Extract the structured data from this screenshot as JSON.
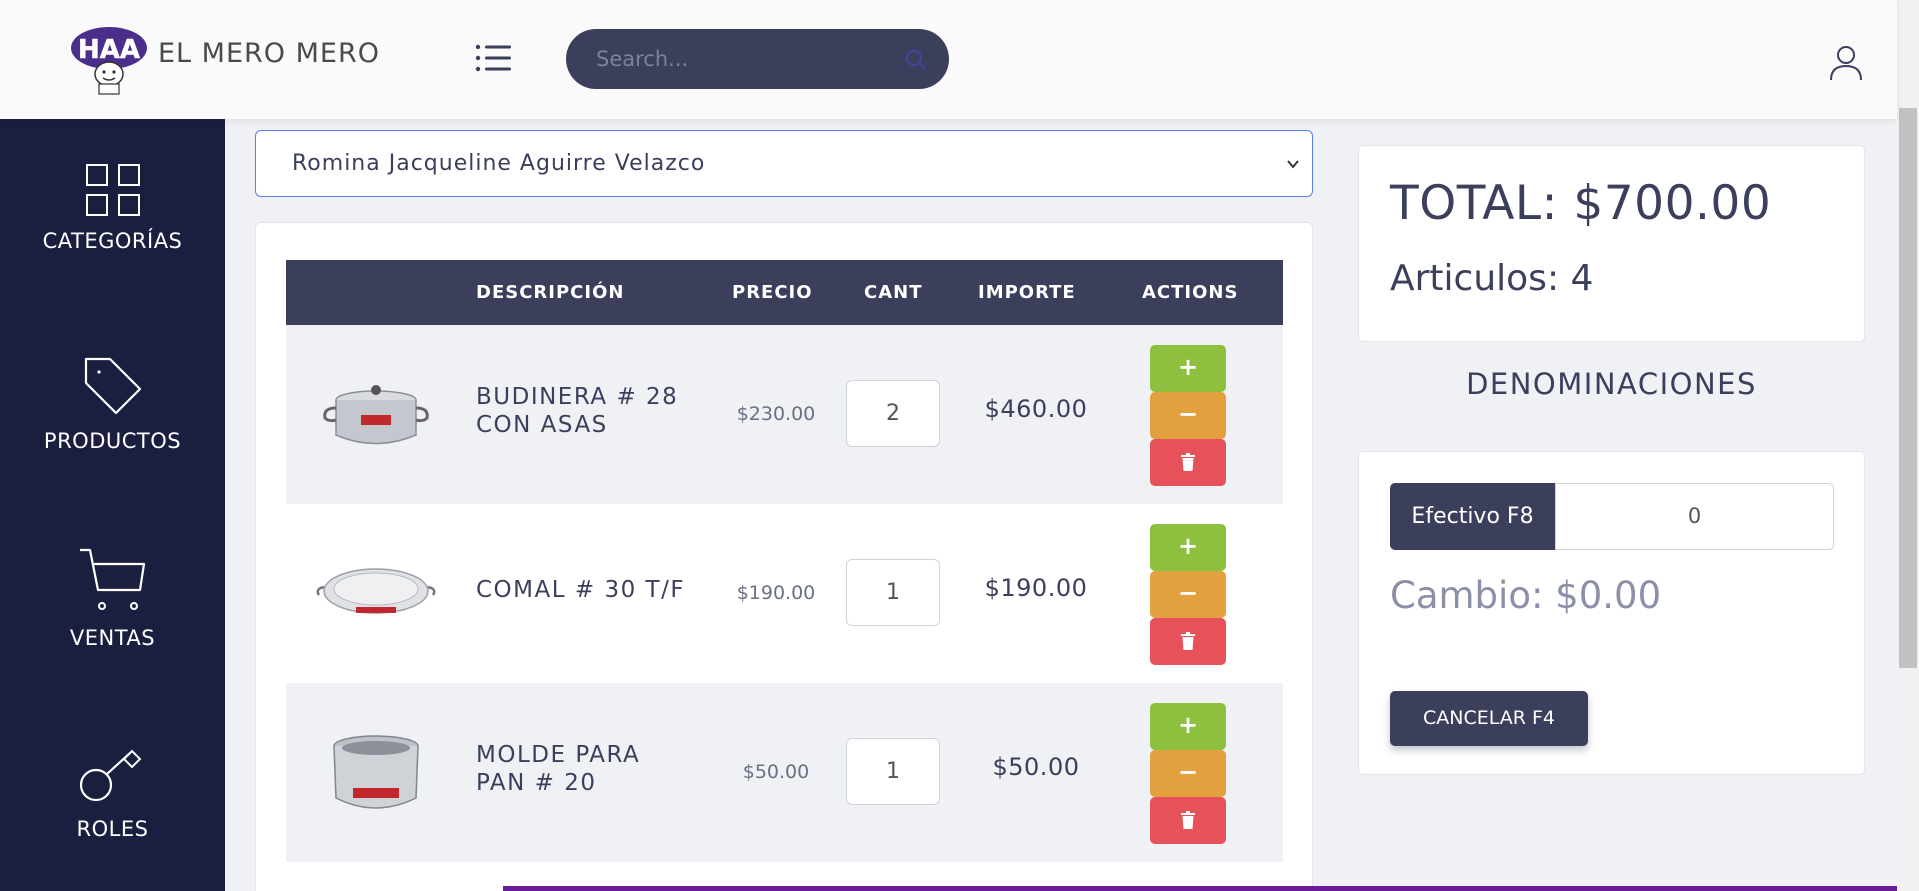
{
  "header": {
    "brand": "EL MERO MERO",
    "logo_text": "HAA",
    "search_placeholder": "Search..."
  },
  "sidebar": {
    "items": [
      {
        "label": "CATEGORÍAS",
        "icon": "grid-icon"
      },
      {
        "label": "PRODUCTOS",
        "icon": "tag-icon"
      },
      {
        "label": "VENTAS",
        "icon": "cart-icon"
      },
      {
        "label": "ROLES",
        "icon": "key-icon"
      }
    ]
  },
  "customer": {
    "selected": "Romina Jacqueline Aguirre Velazco"
  },
  "table": {
    "headers": [
      "DESCRIPCIÓN",
      "PRECIO",
      "CANT",
      "IMPORTE",
      "ACTIONS"
    ],
    "rows": [
      {
        "desc_line1": "BUDINERA # 28",
        "desc_line2": "CON ASAS",
        "price": "$230.00",
        "qty": "2",
        "amount": "$460.00",
        "image": "pot-with-handles"
      },
      {
        "desc_line1": "COMAL # 30 T/F",
        "desc_line2": "",
        "price": "$190.00",
        "qty": "1",
        "amount": "$190.00",
        "image": "flat-pan"
      },
      {
        "desc_line1": "MOLDE PARA",
        "desc_line2": "PAN # 20",
        "price": "$50.00",
        "qty": "1",
        "amount": "$50.00",
        "image": "baking-mold"
      }
    ],
    "actions": {
      "plus": "+",
      "minus": "−"
    }
  },
  "summary": {
    "total": "TOTAL: $700.00",
    "articles": "Articulos: 4",
    "denominations_title": "DENOMINACIONES",
    "cash_label": "Efectivo F8",
    "cash_value": "0",
    "change": "Cambio: $0.00",
    "cancel_label": "CANCELAR F4"
  },
  "colors": {
    "sidebar": "#1b1f3f",
    "primary": "#3b3f5c",
    "plus": "#8dc03f",
    "minus": "#e2a03f",
    "delete": "#e7515a"
  }
}
